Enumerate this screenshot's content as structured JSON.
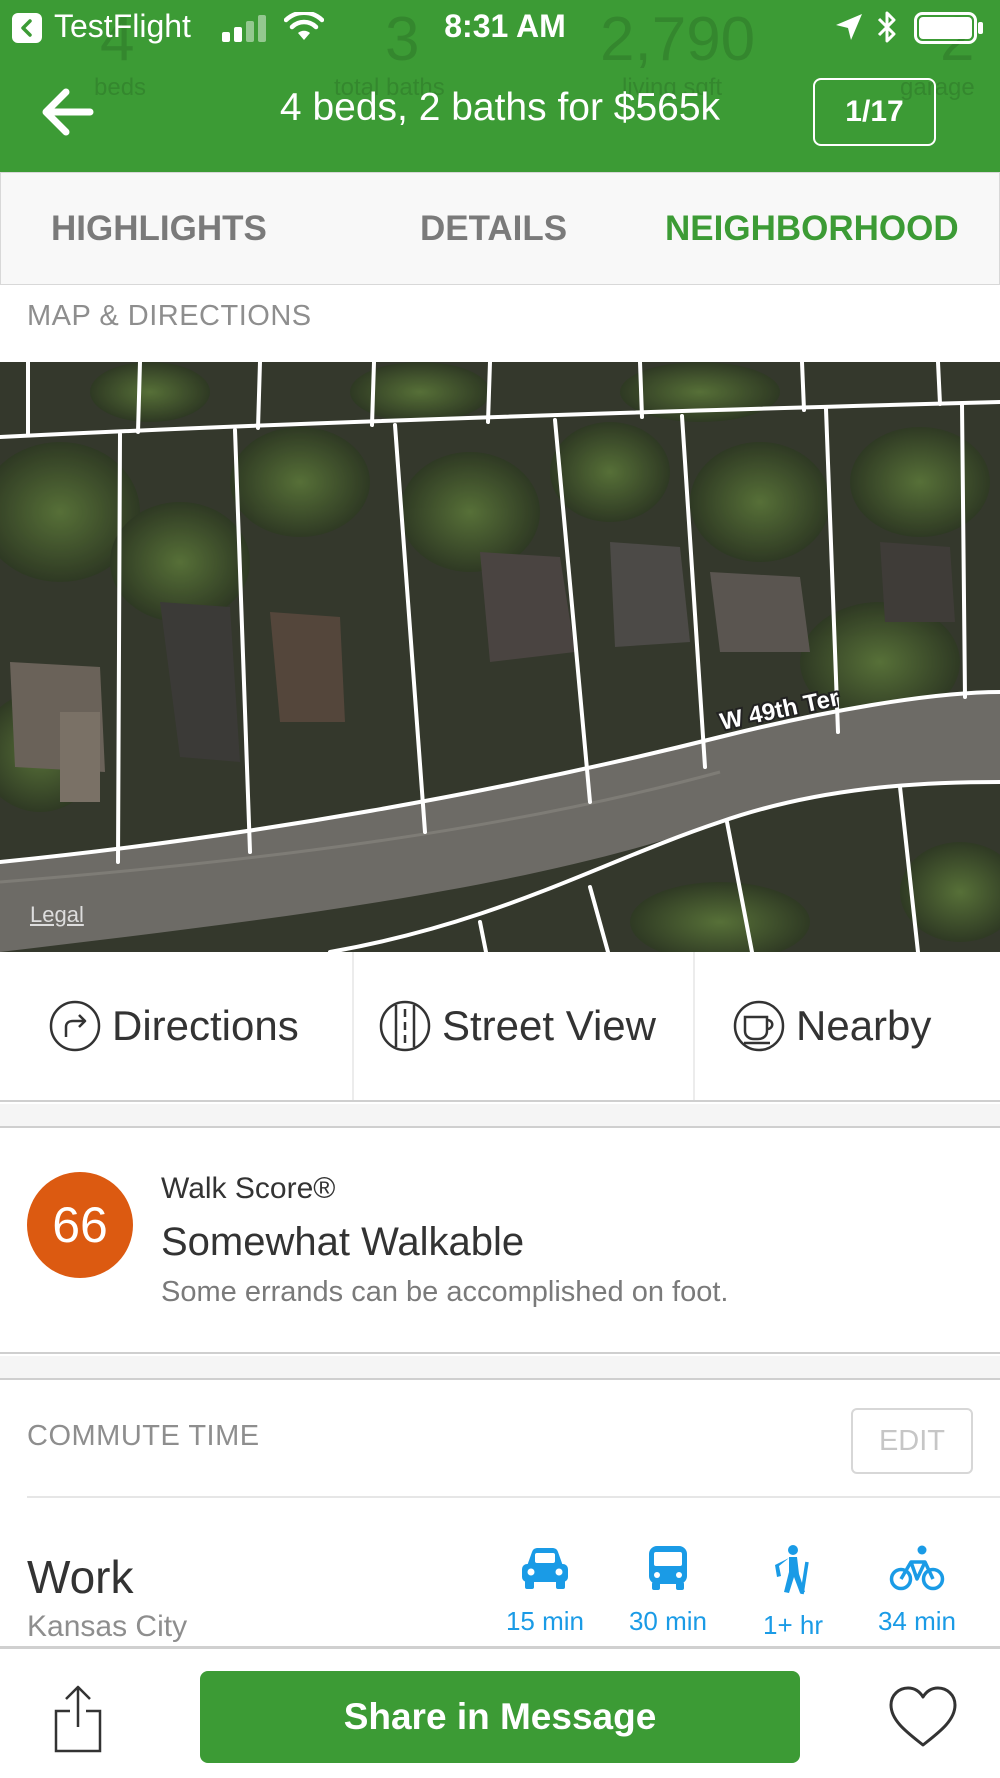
{
  "status_bar": {
    "back_app": "TestFlight",
    "time": "8:31 AM"
  },
  "background_stats": [
    {
      "value": "4",
      "label": "beds"
    },
    {
      "value": "3",
      "label": "total baths"
    },
    {
      "value": "2,790",
      "label": "living sqft"
    },
    {
      "value": "2",
      "label": "garage"
    }
  ],
  "header": {
    "title": "4 beds, 2 baths for $565k",
    "counter": "1/17",
    "accent_color": "#3c9b35"
  },
  "tabs": [
    {
      "label": "HIGHLIGHTS",
      "active": false
    },
    {
      "label": "DETAILS",
      "active": false
    },
    {
      "label": "NEIGHBORHOOD",
      "active": true
    }
  ],
  "map_section": {
    "label": "MAP & DIRECTIONS",
    "street_label": "W 49th Ter",
    "legal": "Legal"
  },
  "actions": [
    {
      "label": "Directions",
      "icon": "directions-icon"
    },
    {
      "label": "Street View",
      "icon": "street-view-icon"
    },
    {
      "label": "Nearby",
      "icon": "coffee-cup-icon"
    }
  ],
  "walk_score": {
    "score": "66",
    "brand": "Walk Score®",
    "rating": "Somewhat Walkable",
    "description": "Some errands can be accomplished on foot.",
    "badge_color": "#dc5a11"
  },
  "commute": {
    "label": "COMMUTE TIME",
    "edit_label": "EDIT",
    "destination": "Work",
    "location": "Kansas City",
    "modes": [
      {
        "icon": "car-icon",
        "time": "15 min"
      },
      {
        "icon": "bus-icon",
        "time": "30 min"
      },
      {
        "icon": "walking-hiker-icon",
        "time": "1+ hr"
      },
      {
        "icon": "bicycle-icon",
        "time": "34 min"
      }
    ],
    "mode_color": "#1a9be6"
  },
  "bottom_bar": {
    "share_label": "Share in Message",
    "share_icon": "share-icon",
    "favorite_icon": "heart-icon"
  }
}
